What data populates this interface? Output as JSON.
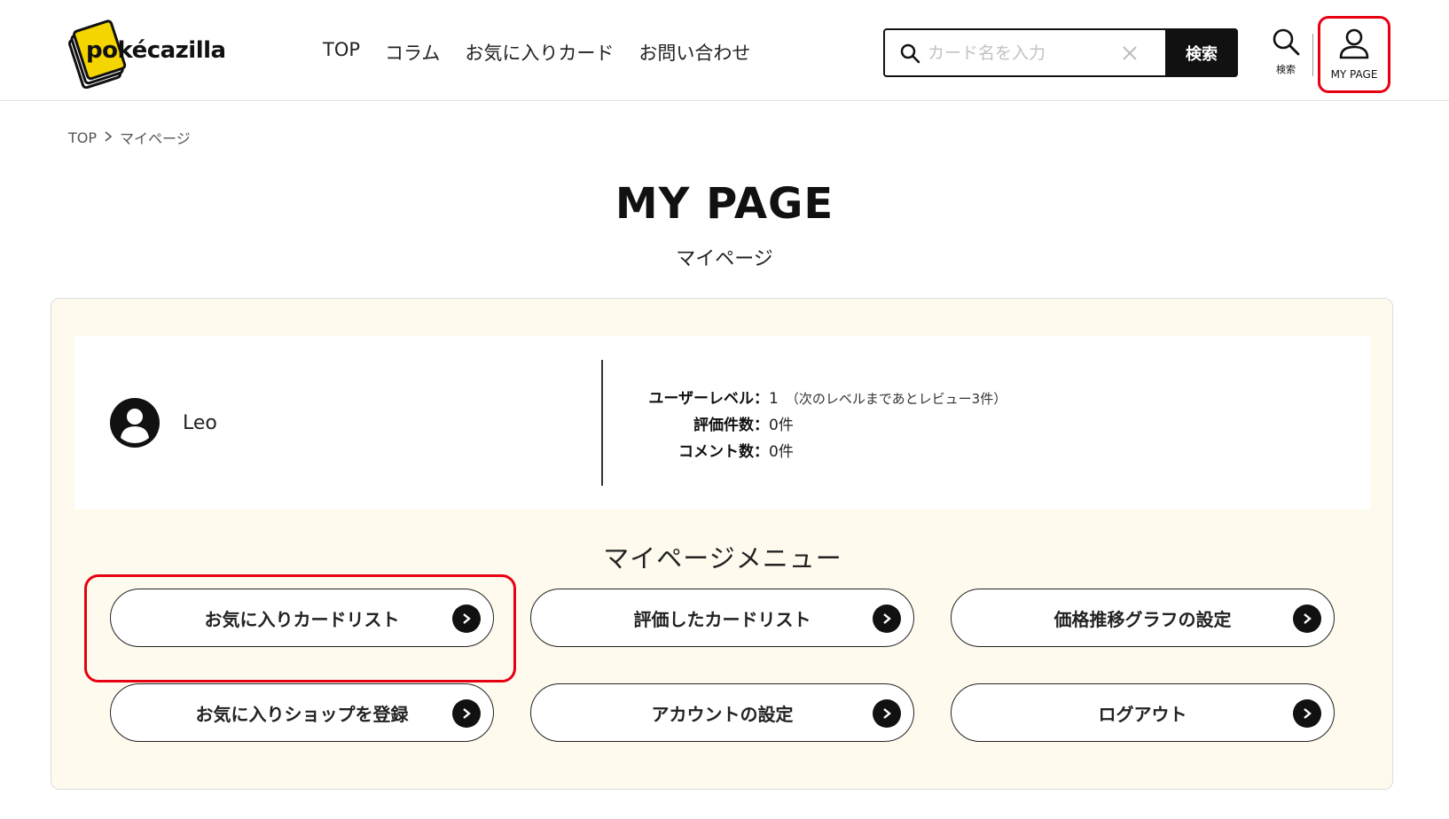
{
  "header": {
    "logo_text": "pokécazilla",
    "nav": [
      "TOP",
      "コラム",
      "お気に入りカード",
      "お問い合わせ"
    ],
    "search": {
      "placeholder": "カード名を入力",
      "button": "検索"
    },
    "icon_search_label": "検索",
    "mypage_label": "MY PAGE"
  },
  "breadcrumb": {
    "home": "TOP",
    "separator": ">",
    "current": "マイページ"
  },
  "page": {
    "title": "MY PAGE",
    "subtitle": "マイページ"
  },
  "profile": {
    "username": "Leo",
    "stats": [
      {
        "label": "ユーザーレベル：",
        "value": "1",
        "note": "（次のレベルまであとレビュー3件）"
      },
      {
        "label": "評価件数：",
        "value": "0件",
        "note": ""
      },
      {
        "label": "コメント数：",
        "value": "0件",
        "note": ""
      }
    ]
  },
  "menu": {
    "title": "マイページメニュー",
    "items": [
      "お気に入りカードリスト",
      "評価したカードリスト",
      "価格推移グラフの設定",
      "お気に入りショップを登録",
      "アカウントの設定",
      "ログアウト"
    ]
  },
  "colors": {
    "accent_highlight": "#e60012",
    "panel_bg": "#fefbee",
    "logo_yellow": "#f5d500"
  }
}
